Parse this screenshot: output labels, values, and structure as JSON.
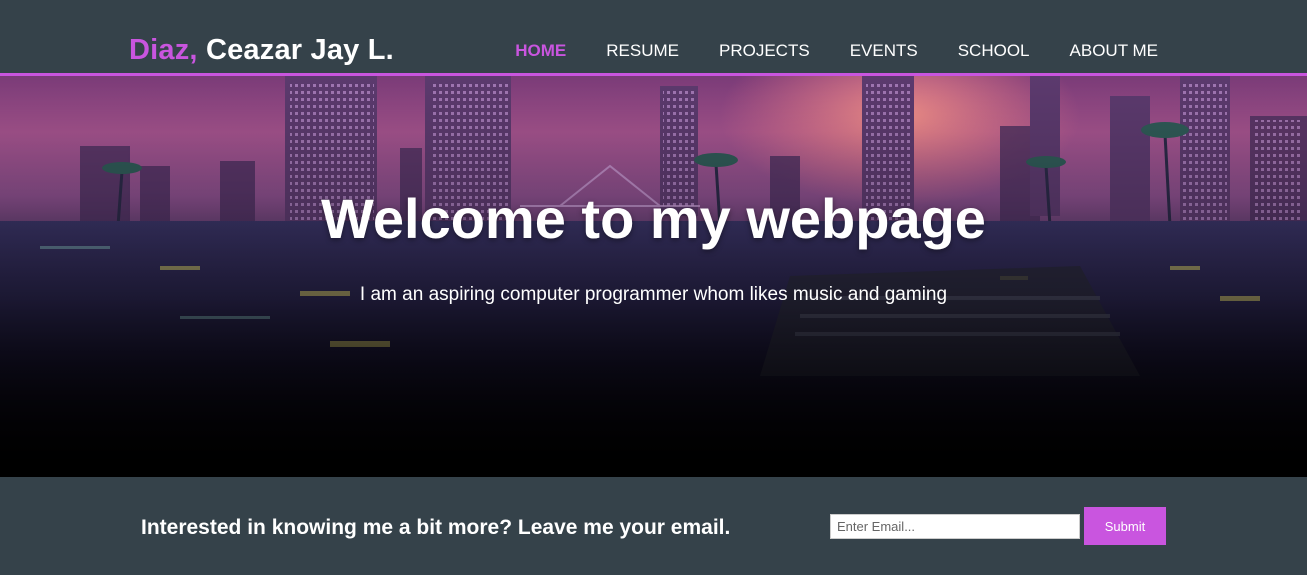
{
  "header": {
    "brand_highlight": "Diaz,",
    "brand_rest": "Ceazar Jay L.",
    "nav": [
      {
        "label": "HOME",
        "active": true
      },
      {
        "label": "RESUME",
        "active": false
      },
      {
        "label": "PROJECTS",
        "active": false
      },
      {
        "label": "EVENTS",
        "active": false
      },
      {
        "label": "SCHOOL",
        "active": false
      },
      {
        "label": "ABOUT ME",
        "active": false
      }
    ]
  },
  "hero": {
    "title": "Welcome to my webpage",
    "subtitle": "I am an aspiring computer programmer whom likes music and gaming"
  },
  "newsletter": {
    "text": "Interested in knowing me a bit more? Leave me your email.",
    "email_placeholder": "Enter Email...",
    "submit_label": "Submit"
  },
  "colors": {
    "accent": "#c955df",
    "bar_background": "#35424a",
    "text": "#ffffff"
  }
}
